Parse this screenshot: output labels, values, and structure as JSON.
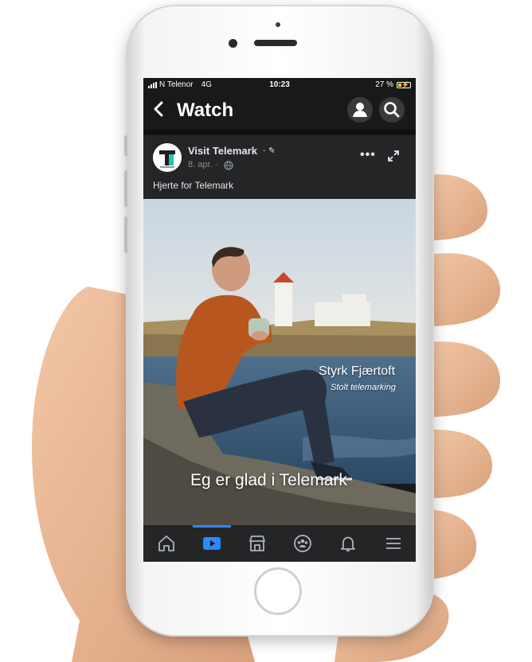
{
  "status_bar": {
    "carrier": "N Telenor",
    "network": "4G",
    "time": "10:23",
    "battery": "27 %"
  },
  "header": {
    "title": "Watch",
    "back_icon": "chevron-left-icon",
    "profile_icon": "person-icon",
    "search_icon": "search-icon"
  },
  "post": {
    "page_name": "Visit Telemark",
    "date": "8. apr. ·",
    "caption": "Hjerte for Telemark",
    "verified_icon": "feather-icon",
    "privacy_icon": "globe-icon"
  },
  "video": {
    "overlay_name": "Styrk Fjærtoft",
    "overlay_subtitle": "Stolt telemarking",
    "overlay_caption": "Eg er glad i Telemark"
  },
  "tabbar": {
    "items": [
      "home-icon",
      "watch-icon",
      "marketplace-icon",
      "groups-icon",
      "bell-icon",
      "menu-icon"
    ],
    "active": "watch-icon"
  },
  "colors": {
    "accent": "#2d88ff",
    "background": "#18191a",
    "card": "#242526",
    "battery": "#f7d22c"
  }
}
